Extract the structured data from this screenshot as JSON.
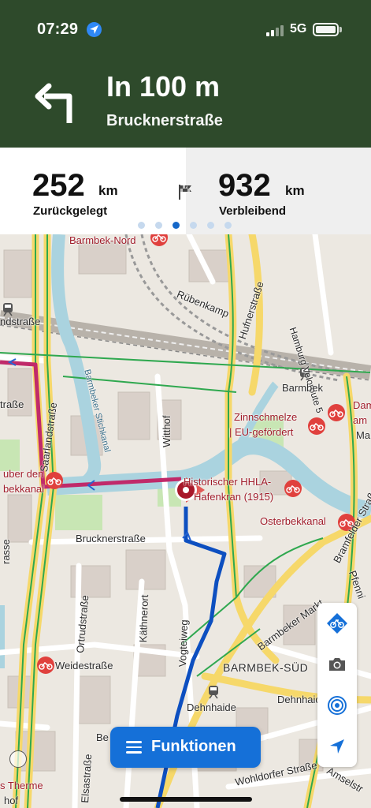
{
  "status_bar": {
    "time": "07:29",
    "network": "5G"
  },
  "instruction": {
    "distance": "In 100 m",
    "street": "Brucknerstraße",
    "icon": "turn-left-icon"
  },
  "stats": {
    "traveled": {
      "value": "252",
      "unit": "km",
      "label": "Zurückgelegt"
    },
    "remaining": {
      "value": "932",
      "unit": "km",
      "label": "Verbleibend"
    },
    "page_count": 6,
    "active_page": 3
  },
  "map_labels": {
    "barmbek_nord": "Barmbek-Nord",
    "ruebenkamp": "Rübenkamp",
    "hufnerstrasse": "Hufnerstraße",
    "veloroute": "Hamburg Veloroute 5",
    "andstrasse": "ndstraße",
    "barmbek": "Barmbek",
    "dam": "Dam",
    "am": "am",
    "ma": "Ma",
    "strasse_left": "traße",
    "saarlandstrasse": "Saarlandstraße",
    "stichkanal": "Barmbeker Stichkanal",
    "zinnschmelze": "Zinnschmelze",
    "eu_gefoerdert": "| EU-gefördert",
    "witthof": "Witthof",
    "uber_den": "uber den",
    "bekkanal": "bekkanal",
    "historischer": "Historischer HHLA-",
    "hafenkran": "Hafenkran (1915)",
    "osterbekkanal": "Osterbekkanal",
    "bramfelder": "Bramfelder Straße",
    "brucknerstrasse": "Brucknerstraße",
    "pfenni": "Pfenni",
    "ortrudstrasse": "Ortrudstraße",
    "kaethnerort": "Käthnerort",
    "vogteiweg": "Vogteiweg",
    "barmbeker_markt": "Barmbeker Markt",
    "weidestrasse": "Weidestraße",
    "barmbek_sued": "BARMBEK-SÜD",
    "dehnhaide_street": "Dehnhaide",
    "dehnhaide_station": "Dehnhaide",
    "rasse": "rasse",
    "be": "Be",
    "wohldorfer": "Wohldorfer Straße",
    "amselstr": "Amselstr",
    "s_therme": "s Therme",
    "elsastrasse": "Elsastraße",
    "hof": "hof"
  },
  "controls": [
    "bike-route-icon",
    "camera-icon",
    "broadcast-icon",
    "navigation-arrow-icon"
  ],
  "functions_button": {
    "label": "Funktionen"
  },
  "colors": {
    "header": "#2e4a2b",
    "accent": "#1570d8",
    "route": "#0d4fc0",
    "traveled_route": "#c02a6a",
    "water": "#aad3df",
    "bike_path": "#2fa84f"
  }
}
